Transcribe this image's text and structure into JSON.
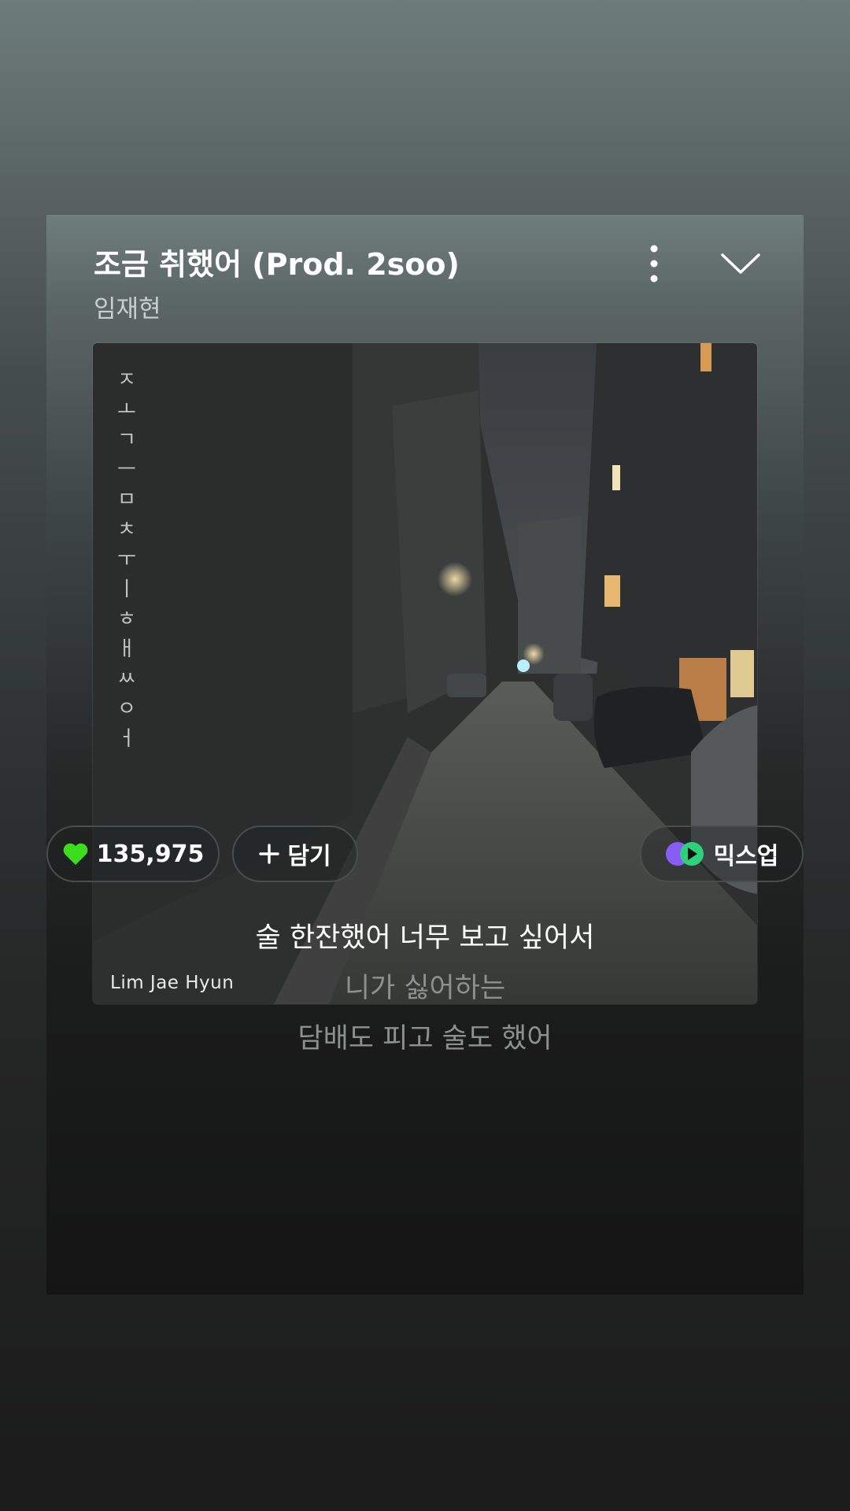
{
  "player": {
    "title": "조금 취했어 (Prod. 2soo)",
    "artist": "임재현",
    "more_icon": "more-vertical-icon",
    "collapse_icon": "chevron-down-icon"
  },
  "album_art": {
    "vertical_text": "ㅈㅗㄱㅡㅁㅊㅜㅣㅎㅐㅆㅇㅓ",
    "credit": "Lim Jae Hyun"
  },
  "actions": {
    "like_count": "135,975",
    "like_icon": "heart-icon",
    "like_color": "#3ddc1f",
    "add_label": "담기",
    "add_icon": "plus-icon",
    "mix_label": "믹스업",
    "mix_icon": "mixup-icon"
  },
  "lyrics": [
    "술 한잔했어 너무 보고 싶어서",
    "니가 싫어하는",
    "담배도 피고 술도 했어"
  ]
}
